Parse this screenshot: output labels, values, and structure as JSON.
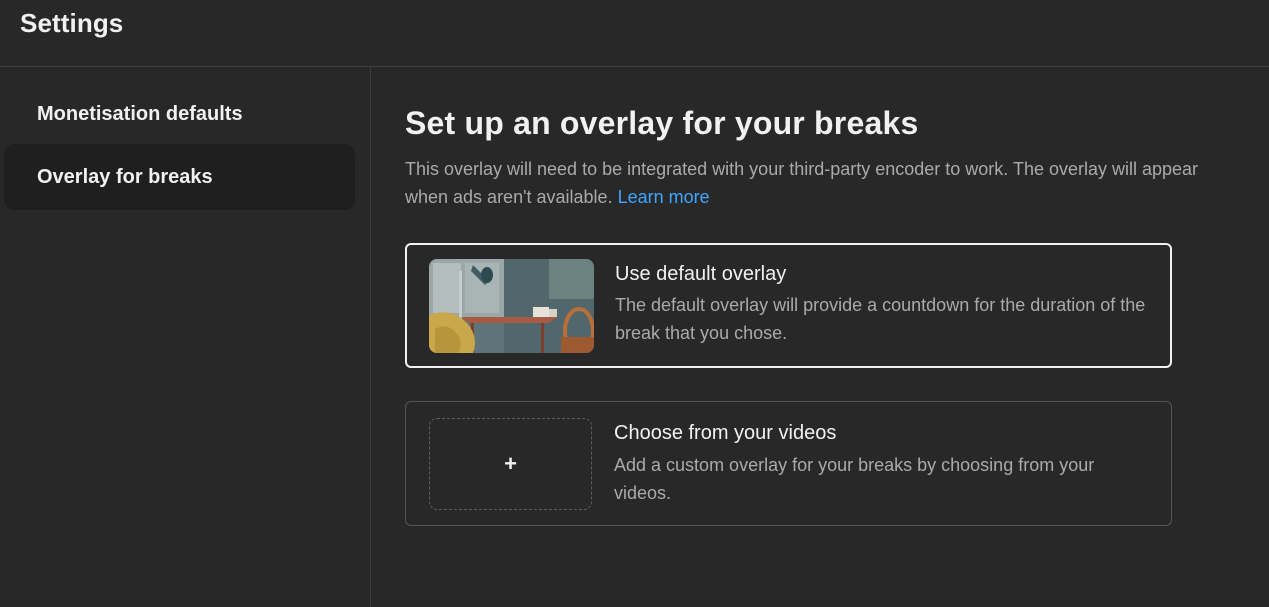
{
  "header": {
    "title": "Settings"
  },
  "sidebar": {
    "items": [
      {
        "label": "Monetisation defaults"
      },
      {
        "label": "Overlay for breaks"
      }
    ]
  },
  "main": {
    "heading": "Set up an overlay for your breaks",
    "description": "This overlay will need to be integrated with your third-party encoder to work. The overlay will appear when ads aren't available.",
    "learn_more": "Learn more",
    "options": [
      {
        "title": "Use default overlay",
        "description": "The default overlay will provide a countdown for the duration of the break that you chose."
      },
      {
        "title": "Choose from your videos",
        "description": "Add a custom overlay for your breaks by choosing from your videos.",
        "add_symbol": "+"
      }
    ]
  },
  "colors": {
    "background": "#282828",
    "selected_nav": "#1f1f1f",
    "link": "#3ea6ff",
    "secondary_text": "#aaaaaa"
  }
}
